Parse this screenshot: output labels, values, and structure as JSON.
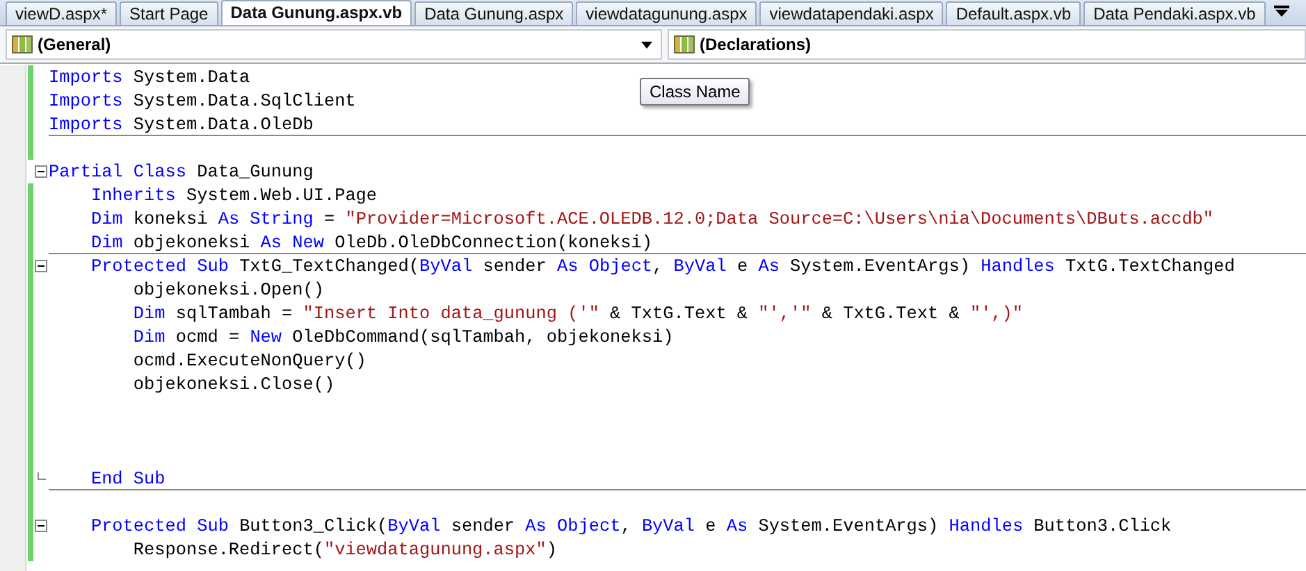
{
  "tabs": [
    {
      "label": "viewD.aspx*",
      "selected": false
    },
    {
      "label": "Start Page",
      "selected": false
    },
    {
      "label": "Data Gunung.aspx.vb",
      "selected": true
    },
    {
      "label": "Data Gunung.aspx",
      "selected": false
    },
    {
      "label": "viewdatagunung.aspx",
      "selected": false
    },
    {
      "label": "viewdatapendaki.aspx",
      "selected": false
    },
    {
      "label": "Default.aspx.vb",
      "selected": false
    },
    {
      "label": "Data Pendaki.aspx.vb",
      "selected": false
    }
  ],
  "class_dropdown": {
    "value": "(General)"
  },
  "member_dropdown": {
    "value": "(Declarations)"
  },
  "tooltip": {
    "text": "Class Name"
  },
  "code_lines": [
    {
      "changed": true,
      "tokens": [
        {
          "kind": "keyword",
          "text": "Imports"
        },
        {
          "kind": "plain",
          "text": " System.Data"
        }
      ]
    },
    {
      "changed": true,
      "tokens": [
        {
          "kind": "keyword",
          "text": "Imports"
        },
        {
          "kind": "plain",
          "text": " System.Data.SqlClient"
        }
      ]
    },
    {
      "changed": true,
      "separator": true,
      "tokens": [
        {
          "kind": "keyword",
          "text": "Imports"
        },
        {
          "kind": "plain",
          "text": " System.Data.OleDb"
        }
      ]
    },
    {
      "changed": true
    },
    {
      "changed": false,
      "collapsible": true,
      "tokens": [
        {
          "kind": "keyword",
          "text": "Partial"
        },
        {
          "kind": "keyword",
          "text": " Class"
        },
        {
          "kind": "plain",
          "text": " Data_Gunung"
        }
      ]
    },
    {
      "changed": true,
      "tokens": [
        {
          "kind": "keyword",
          "text": "    Inherits"
        },
        {
          "kind": "plain",
          "text": " System.Web.UI.Page"
        }
      ]
    },
    {
      "changed": true,
      "tokens": [
        {
          "kind": "keyword",
          "text": "    Dim"
        },
        {
          "kind": "plain",
          "text": " koneksi "
        },
        {
          "kind": "keyword",
          "text": "As"
        },
        {
          "kind": "keyword",
          "text": " String"
        },
        {
          "kind": "plain",
          "text": " = "
        },
        {
          "kind": "string",
          "text": "\"Provider=Microsoft.ACE.OLEDB.12.0;Data Source=C:\\Users\\nia\\Documents\\DButs.accdb\""
        }
      ]
    },
    {
      "changed": true,
      "separator": true,
      "tokens": [
        {
          "kind": "keyword",
          "text": "    Dim"
        },
        {
          "kind": "plain",
          "text": " objekoneksi "
        },
        {
          "kind": "keyword",
          "text": "As"
        },
        {
          "kind": "keyword",
          "text": " New"
        },
        {
          "kind": "plain",
          "text": " OleDb.OleDbConnection(koneksi)"
        }
      ]
    },
    {
      "changed": true,
      "collapsible": true,
      "tokens": [
        {
          "kind": "keyword",
          "text": "    Protected"
        },
        {
          "kind": "keyword",
          "text": " Sub"
        },
        {
          "kind": "plain",
          "text": " TxtG_TextChanged("
        },
        {
          "kind": "keyword",
          "text": "ByVal"
        },
        {
          "kind": "plain",
          "text": " sender "
        },
        {
          "kind": "keyword",
          "text": "As"
        },
        {
          "kind": "keyword",
          "text": " Object"
        },
        {
          "kind": "plain",
          "text": ", "
        },
        {
          "kind": "keyword",
          "text": "ByVal"
        },
        {
          "kind": "plain",
          "text": " e "
        },
        {
          "kind": "keyword",
          "text": "As"
        },
        {
          "kind": "plain",
          "text": " System.EventArgs) "
        },
        {
          "kind": "keyword",
          "text": "Handles"
        },
        {
          "kind": "plain",
          "text": " TxtG.TextChanged"
        }
      ]
    },
    {
      "changed": true,
      "tokens": [
        {
          "kind": "plain",
          "text": "        objekoneksi.Open()"
        }
      ]
    },
    {
      "changed": true,
      "tokens": [
        {
          "kind": "keyword",
          "text": "        Dim"
        },
        {
          "kind": "plain",
          "text": " sqlTambah = "
        },
        {
          "kind": "string",
          "text": "\"Insert Into data_gunung ('\""
        },
        {
          "kind": "plain",
          "text": " & TxtG.Text & "
        },
        {
          "kind": "string",
          "text": "\"','\""
        },
        {
          "kind": "plain",
          "text": " & TxtG.Text & "
        },
        {
          "kind": "string",
          "text": "\"',)\""
        }
      ]
    },
    {
      "changed": true,
      "tokens": [
        {
          "kind": "keyword",
          "text": "        Dim"
        },
        {
          "kind": "plain",
          "text": " ocmd = "
        },
        {
          "kind": "keyword",
          "text": "New"
        },
        {
          "kind": "plain",
          "text": " OleDbCommand(sqlTambah, objekoneksi)"
        }
      ]
    },
    {
      "changed": true,
      "tokens": [
        {
          "kind": "plain",
          "text": "        ocmd.ExecuteNonQuery()"
        }
      ]
    },
    {
      "changed": true,
      "tokens": [
        {
          "kind": "plain",
          "text": "        objekoneksi.Close()"
        }
      ]
    },
    {
      "changed": true
    },
    {
      "changed": true
    },
    {
      "changed": true
    },
    {
      "changed": true,
      "block_end": true,
      "separator": true,
      "tokens": [
        {
          "kind": "keyword",
          "text": "    End"
        },
        {
          "kind": "keyword",
          "text": " Sub"
        }
      ]
    },
    {
      "changed": true
    },
    {
      "changed": true,
      "collapsible": true,
      "tokens": [
        {
          "kind": "keyword",
          "text": "    Protected"
        },
        {
          "kind": "keyword",
          "text": " Sub"
        },
        {
          "kind": "plain",
          "text": " Button3_Click("
        },
        {
          "kind": "keyword",
          "text": "ByVal"
        },
        {
          "kind": "plain",
          "text": " sender "
        },
        {
          "kind": "keyword",
          "text": "As"
        },
        {
          "kind": "keyword",
          "text": " Object"
        },
        {
          "kind": "plain",
          "text": ", "
        },
        {
          "kind": "keyword",
          "text": "ByVal"
        },
        {
          "kind": "plain",
          "text": " e "
        },
        {
          "kind": "keyword",
          "text": "As"
        },
        {
          "kind": "plain",
          "text": " System.EventArgs) "
        },
        {
          "kind": "keyword",
          "text": "Handles"
        },
        {
          "kind": "plain",
          "text": " Button3.Click"
        }
      ]
    },
    {
      "changed": true,
      "tokens": [
        {
          "kind": "plain",
          "text": "        Response.Redirect("
        },
        {
          "kind": "string",
          "text": "\"viewdatagunung.aspx\""
        },
        {
          "kind": "plain",
          "text": ")"
        }
      ]
    }
  ]
}
